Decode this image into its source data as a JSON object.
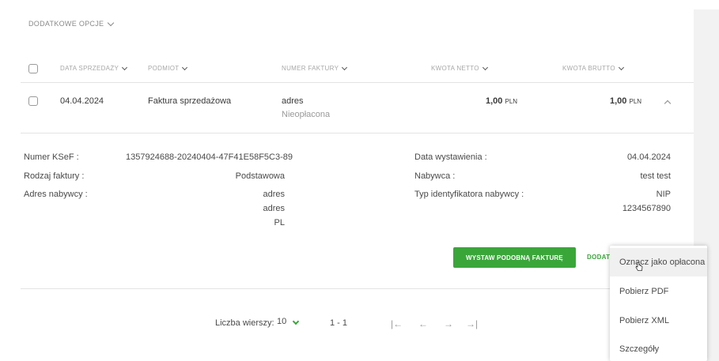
{
  "options": {
    "label": "DODATKOWE OPCJE"
  },
  "table": {
    "headers": {
      "date": "DATA SPRZEDAŻY",
      "type": "PODMIOT",
      "number": "NUMER FAKTURY",
      "net": "KWOTA NETTO",
      "gross": "KWOTA BRUTTO"
    },
    "row": {
      "date": "04.04.2024",
      "type": "Faktura sprzedażowa",
      "number": "adres",
      "status": "Nieopłacona",
      "net": "1,00",
      "net_currency": "PLN",
      "gross": "1,00",
      "gross_currency": "PLN"
    }
  },
  "details": {
    "ksef_label": "Numer KSeF :",
    "ksef_value": "1357924688-20240404-47F41E58F5C3-89",
    "kind_label": "Rodzaj faktury :",
    "kind_value": "Podstawowa",
    "address_label": "Adres nabywcy :",
    "address_line1": "adres",
    "address_line2": "adres",
    "address_line3": "PL",
    "issue_label": "Data wystawienia :",
    "issue_value": "04.04.2024",
    "buyer_label": "Nabywca :",
    "buyer_value": "test test",
    "idtype_label": "Typ identyfikatora nabywcy :",
    "idtype_value": "NIP",
    "id_value": "1234567890"
  },
  "actions": {
    "similar_invoice": "WYSTAW PODOBNĄ FAKTURĘ",
    "more": "DODAT"
  },
  "menu": {
    "items": [
      "Oznacz jako opłacona",
      "Pobierz PDF",
      "Pobierz XML",
      "Szczegóły"
    ]
  },
  "pager": {
    "rows_label": "Liczba wierszy:",
    "rows_value": "10",
    "range": "1 - 1",
    "first": "|←",
    "prev": "←",
    "next": "→",
    "last": "→|"
  },
  "colors": {
    "accent": "#3aa63a"
  }
}
